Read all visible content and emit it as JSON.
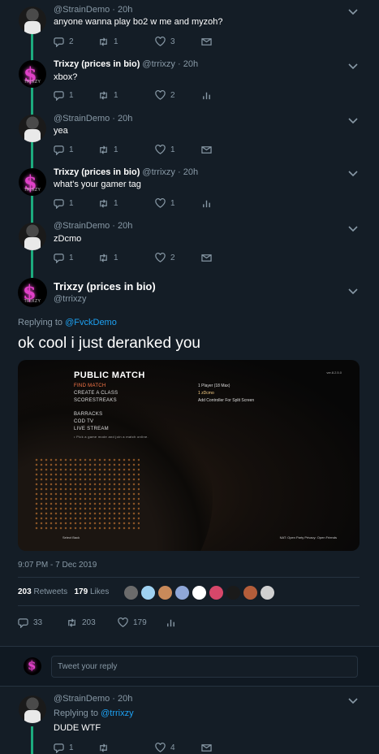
{
  "colors": {
    "background": "#141d26",
    "thread_line": "#1dab7e",
    "link": "#1da1f2",
    "muted": "#8899a6"
  },
  "tweets": [
    {
      "user": "StrainDemo",
      "time": "20h",
      "text": "anyone wanna play bo2 w me and myzoh?",
      "replies": "2",
      "retweets": "1",
      "likes": "3"
    },
    {
      "name": "Trixzy (prices in bio)",
      "handle": "@trrixzy",
      "time": "20h",
      "text": "xbox?",
      "replies": "1",
      "retweets": "1",
      "likes": "2"
    },
    {
      "user": "StrainDemo",
      "time": "20h",
      "text": "yea",
      "replies": "1",
      "retweets": "1",
      "likes": "1"
    },
    {
      "name": "Trixzy (prices in bio)",
      "handle": "@trrixzy",
      "time": "20h",
      "text": "what's your gamer tag",
      "replies": "1",
      "retweets": "1",
      "likes": "1"
    },
    {
      "user": "StrainDemo",
      "time": "20h",
      "text": "zDcmo",
      "replies": "1",
      "retweets": "1",
      "likes": "2"
    }
  ],
  "main": {
    "name": "Trixzy (prices in bio)",
    "handle": "@trrixzy",
    "replying_prefix": "Replying to",
    "replying_to": "@FvckDemo",
    "text": "ok cool i just deranked you",
    "timestamp": "9:07 PM - 7 Dec 2019",
    "retweets": "203",
    "retweets_label": "Retweets",
    "likes": "179",
    "likes_label": "Likes",
    "action_replies": "33",
    "action_retweets": "203",
    "action_likes": "179"
  },
  "media": {
    "title": "PUBLIC MATCH",
    "menu": [
      "FIND MATCH",
      "CREATE A CLASS",
      "SCORESTREAKS",
      "BARRACKS",
      "COD TV",
      "LIVE STREAM"
    ],
    "hint": "• Pick a game mode and join a match online.",
    "player_header": "1 Player (18 Max)",
    "player_row": "1   zDcmo",
    "add_controller": "Add Controller For Split Screen",
    "bottom_left": "Select  Back",
    "bottom_right": "NAT: Open   Party Privacy: Open   Friends",
    "version": "ver.8.2.5.0"
  },
  "reply_placeholder": "Tweet your reply",
  "reply_tweet": {
    "user": "StrainDemo",
    "time": "20h",
    "replying_prefix": "Replying to",
    "replying_to": "@trrixzy",
    "text": "DUDE WTF",
    "replies": "1",
    "likes": "4"
  }
}
